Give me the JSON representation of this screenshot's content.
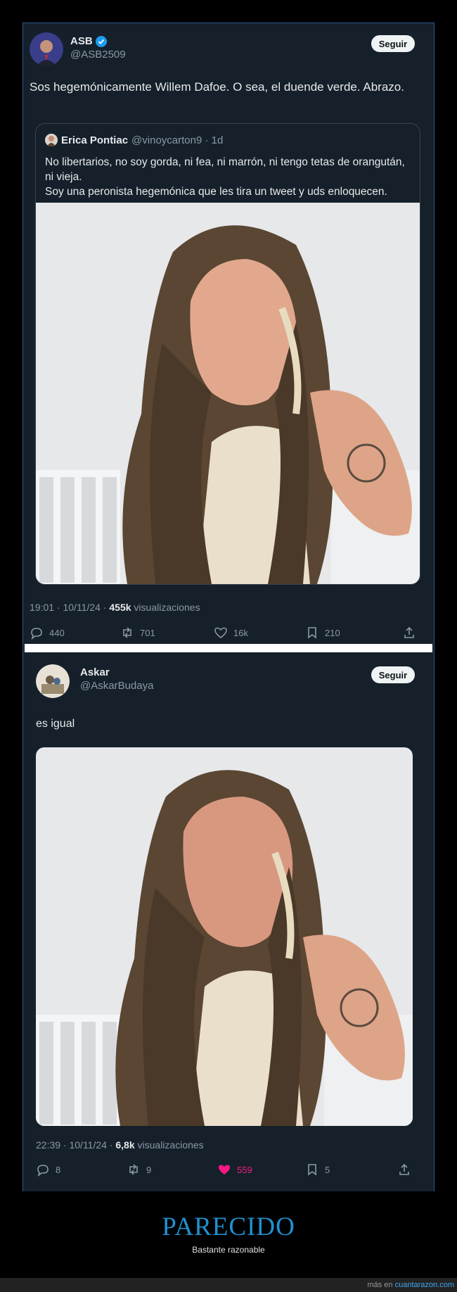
{
  "tweet1": {
    "name": "ASB",
    "handle": "@ASB2509",
    "follow_label": "Seguir",
    "text": "Sos hegemónicamente Willem Dafoe. O sea, el duende verde. Abrazo.",
    "quote": {
      "name": "Erica Pontiac",
      "meta": "@vinoycarton9 · 1d",
      "line1": "No libertarios, no soy gorda, ni fea, ni marrón, ni tengo tetas de orangután,",
      "line2": "ni vieja.",
      "line3": "Soy una peronista hegemónica que les tira un tweet y uds enloquecen."
    },
    "time": "19:01 · 10/11/24 · ",
    "views_count": "455k",
    "views_label": " visualizaciones",
    "replies": "440",
    "retweets": "701",
    "likes": "16k",
    "bookmarks": "210"
  },
  "tweet2": {
    "name": "Askar",
    "handle": "@AskarBudaya",
    "follow_label": "Seguir",
    "text": "es igual",
    "time": "22:39 · 10/11/24 · ",
    "views_count": "6,8k",
    "views_label": " visualizaciones",
    "replies": "8",
    "retweets": "9",
    "likes": "559",
    "bookmarks": "5"
  },
  "caption": {
    "title": "PARECIDO",
    "subtitle": "Bastante razonable"
  },
  "footer": {
    "prefix": "más en ",
    "link": "cuantarazon.com"
  },
  "colors": {
    "background": "#15202b",
    "like_active": "#f91880",
    "accent": "#2090d0"
  }
}
